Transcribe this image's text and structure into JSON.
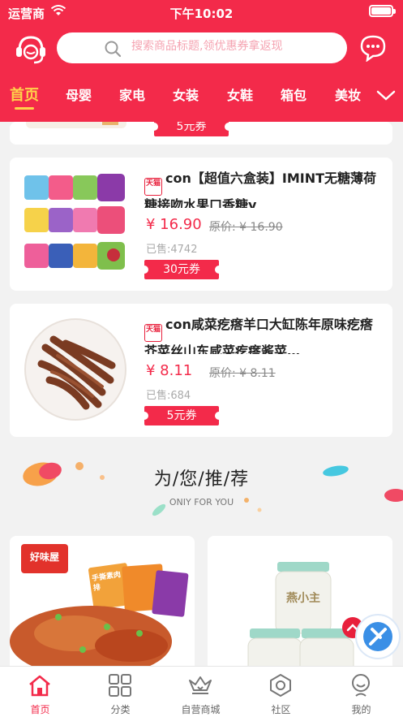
{
  "status": {
    "carrier": "运营商",
    "time": "下午10:02"
  },
  "header": {
    "search_placeholder": "搜索商品标题,领优惠券拿返现",
    "tabs": [
      "首页",
      "母婴",
      "家电",
      "女装",
      "女鞋",
      "箱包",
      "美妆"
    ],
    "active_tab": "首页"
  },
  "partial_card": {
    "coupon": "5元券"
  },
  "products": [
    {
      "badge": "天猫",
      "title": "con【超值六盒装】IMINT无糖薄荷糖接吻水果口香糖y",
      "price": "¥ 16.90",
      "original_price": "原价: ¥ 16.90",
      "sold": "已售:4742",
      "coupon": "30元券"
    },
    {
      "badge": "天猫",
      "title": "con咸菜疙瘩羊口大缸陈年原味疙瘩芥菜丝山东咸菜疙瘩酱菜…",
      "price": "¥ 8.11",
      "original_price": "原价: ¥ 8.11",
      "sold": "已售:684",
      "coupon": "5元券"
    }
  ],
  "recommend": {
    "title": "为/您/推/荐",
    "subtitle": "ONIY FOR YOU"
  },
  "rec_cards": [
    {
      "brand": "好味屋",
      "pack_text": "手撕素肉排"
    },
    {
      "brand": "燕小主"
    }
  ],
  "bottom_nav": [
    {
      "label": "首页",
      "icon": "home-icon"
    },
    {
      "label": "分类",
      "icon": "grid-icon"
    },
    {
      "label": "自营商城",
      "icon": "crown-basket-icon"
    },
    {
      "label": "社区",
      "icon": "hexagon-icon"
    },
    {
      "label": "我的",
      "icon": "person-icon"
    }
  ],
  "colors": {
    "brand_red": "#f32a4a",
    "active_tab": "#ffd24a"
  }
}
